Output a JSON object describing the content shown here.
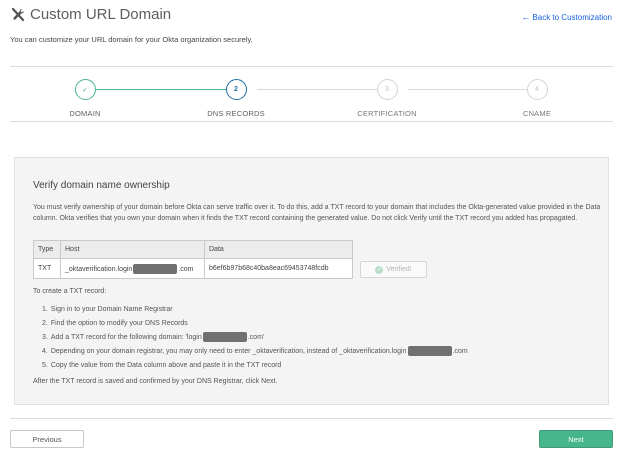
{
  "header": {
    "title": "Custom URL Domain",
    "icon": "tools-icon",
    "back_link": "Back to Customization",
    "subtitle": "You can customize your URL domain for your Okta organization securely."
  },
  "steps": [
    {
      "marker": "✓",
      "label": "DOMAIN",
      "state": "complete"
    },
    {
      "marker": "2",
      "label": "DNS RECORDS",
      "state": "current"
    },
    {
      "marker": "3",
      "label": "CERTIFICATION",
      "state": "pending"
    },
    {
      "marker": "4",
      "label": "CNAME",
      "state": "pending"
    }
  ],
  "panel": {
    "title": "Verify domain name ownership",
    "description": "You must verify ownership of your domain before Okta can serve traffic over it. To do this, add a TXT record to your domain that includes the Okta-generated value provided in the Data column. Okta verifies that you own your domain when it finds the TXT record containing the generated value. Do not click Verify until the TXT record you added has propagated.",
    "table": {
      "headers": [
        "Type",
        "Host",
        "Data"
      ],
      "row": {
        "type": "TXT",
        "host_prefix": "_oktaverification.login",
        "host_suffix": ".com",
        "data": "b6ef6b97b68c40ba8eac69453748fcdb"
      }
    },
    "verified_button": "Verified!",
    "instructions_heading": "To create a TXT record:",
    "instructions": [
      {
        "num": "1.",
        "text": "Sign in to your Domain Name Registrar"
      },
      {
        "num": "2.",
        "text": "Find the option to modify your DNS Records"
      },
      {
        "num": "3.",
        "pre": "Add a TXT record for the following domain: 'login",
        "post": ".com'"
      },
      {
        "num": "4.",
        "pre": "Depending on your domain registrar, you may only need to enter _oktaverification, instead of _oktaverification.login",
        "post": ".com"
      },
      {
        "num": "5.",
        "text": "Copy the value from the Data column above and paste it in the TXT record"
      }
    ],
    "footer_note": "After the TXT record is saved and confirmed by your DNS Registrar, click Next."
  },
  "nav": {
    "previous": "Previous",
    "next": "Next"
  },
  "colors": {
    "accent_green": "#48b68d",
    "current_step_blue": "#1d6fa3",
    "link_blue": "#1662dd"
  }
}
